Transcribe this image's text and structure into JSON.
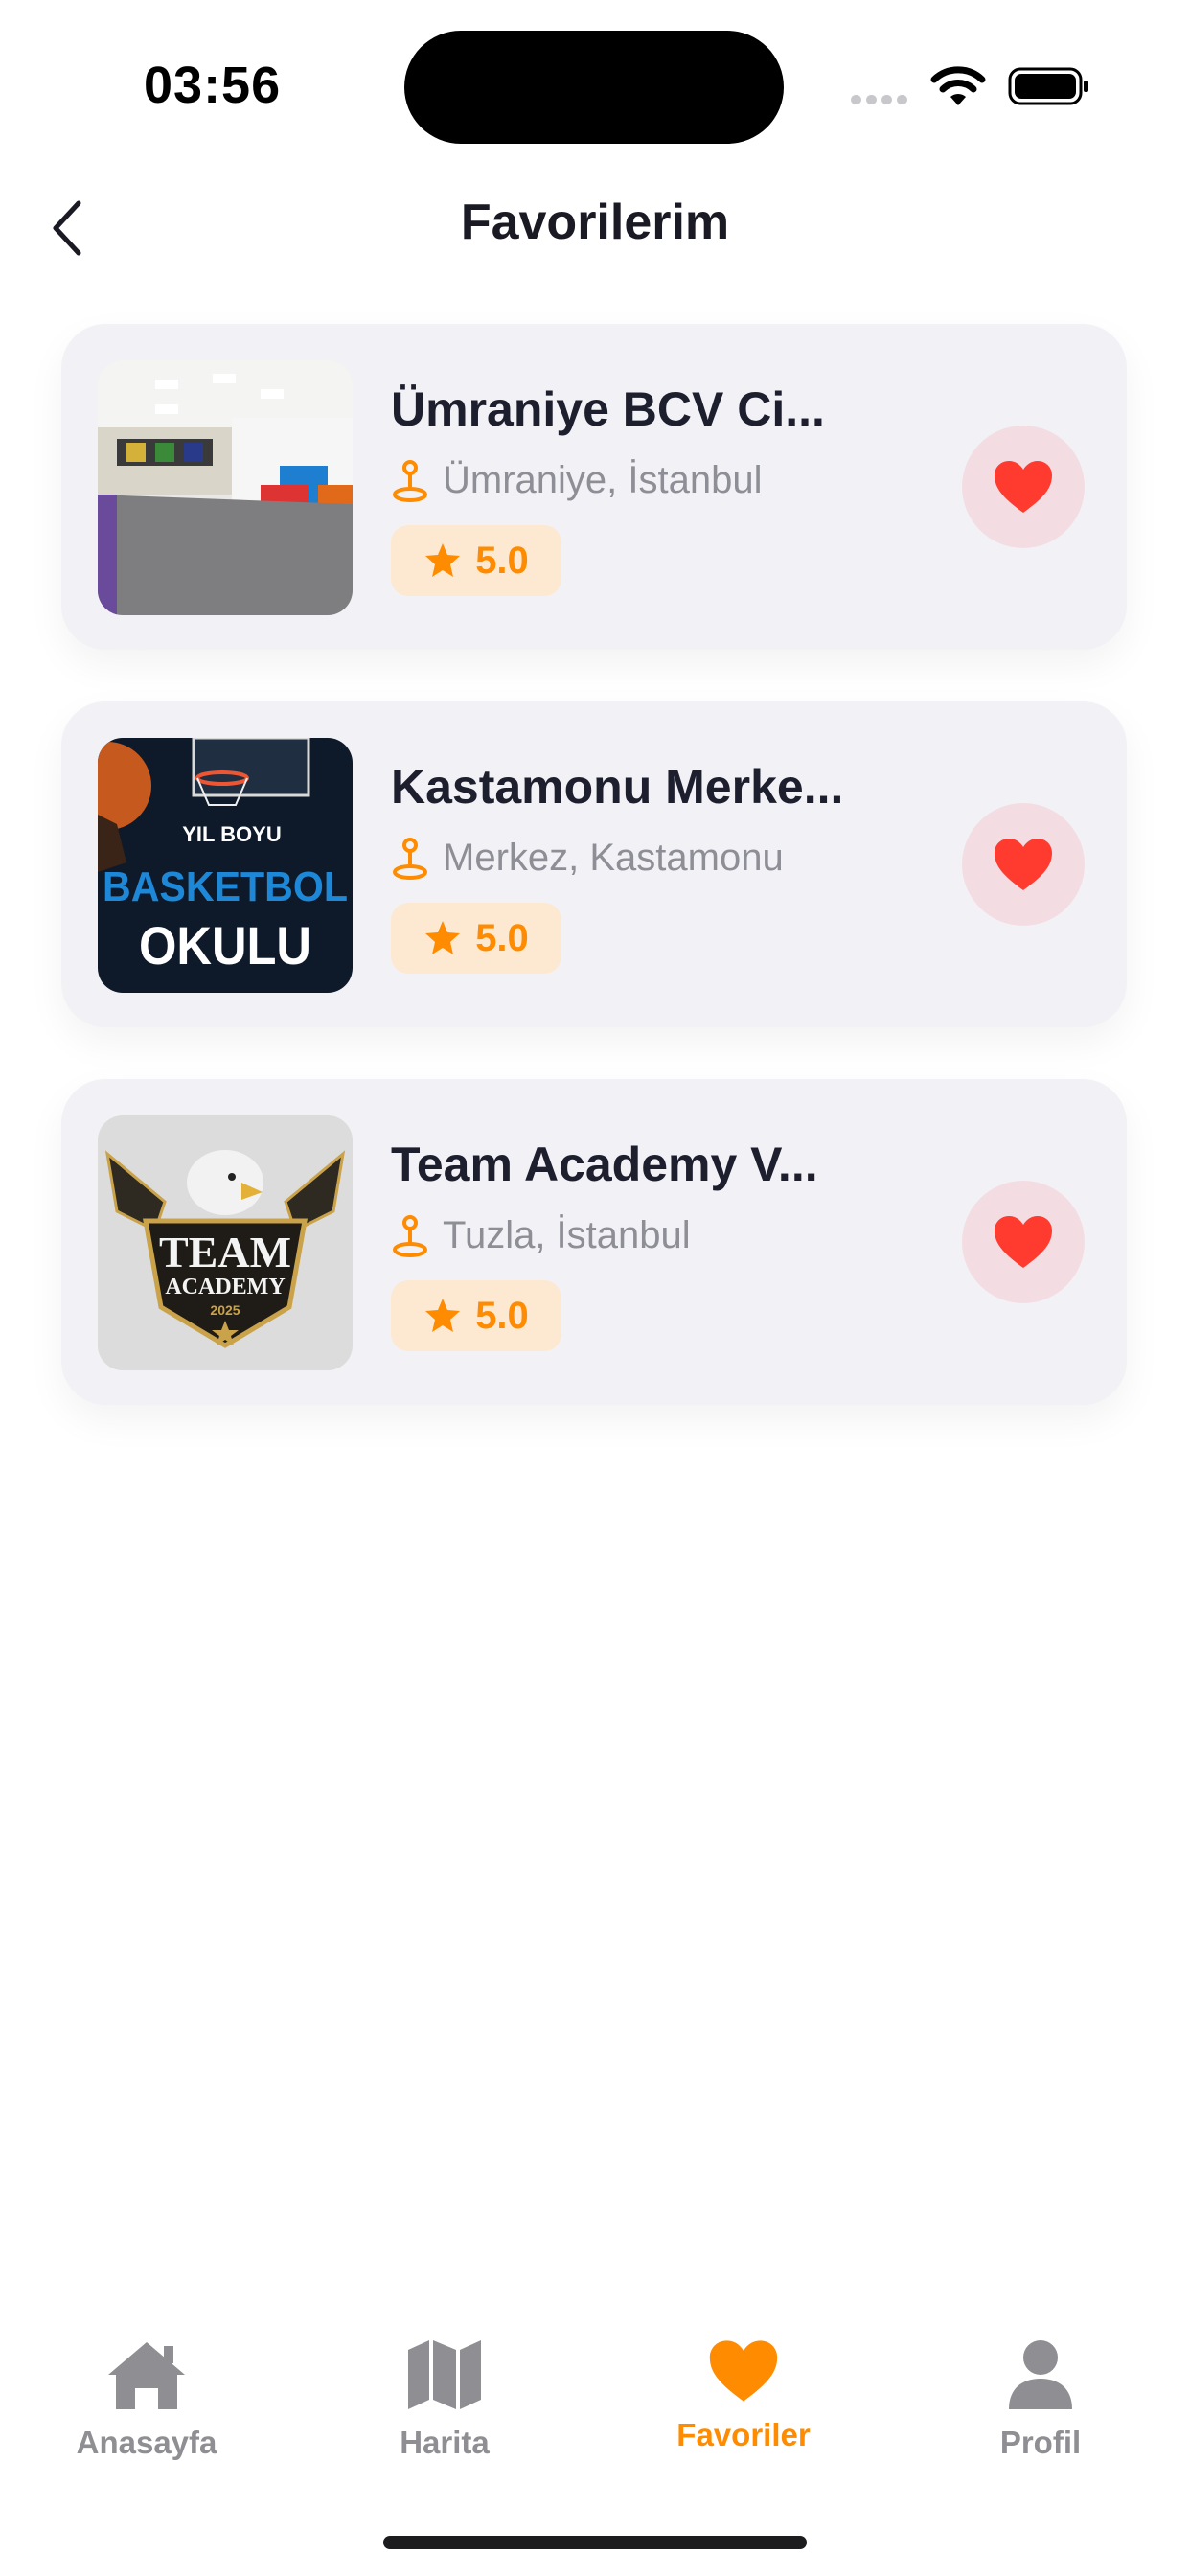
{
  "status_bar": {
    "time": "03:56"
  },
  "header": {
    "title": "Favorilerim"
  },
  "favorites": [
    {
      "title": "Ümraniye BCV Ci...",
      "location": "Ümraniye, İstanbul",
      "rating": "5.0",
      "thumbnail": "indoor-gym-photo"
    },
    {
      "title": "Kastamonu Merke...",
      "location": "Merkez, Kastamonu",
      "rating": "5.0",
      "thumbnail": "basketball-school-poster",
      "poster_lines": [
        "YIL BOYU",
        "BASKETBOL",
        "OKULU"
      ]
    },
    {
      "title": "Team Academy V...",
      "location": "Tuzla, İstanbul",
      "rating": "5.0",
      "thumbnail": "eagle-emblem-logo",
      "logo_text": [
        "TEAM",
        "ACADEMY",
        "2025"
      ]
    }
  ],
  "tabbar": {
    "tabs": [
      {
        "label": "Anasayfa",
        "icon": "home-icon"
      },
      {
        "label": "Harita",
        "icon": "map-icon"
      },
      {
        "label": "Favoriler",
        "icon": "heart-icon",
        "active": true
      },
      {
        "label": "Profil",
        "icon": "person-icon"
      }
    ]
  },
  "colors": {
    "accent": "#ff8c00",
    "heart": "#ff3b30",
    "card_bg": "#f2f2f6",
    "fav_bg": "#f3dde3",
    "rating_bg": "#fde9d1"
  }
}
